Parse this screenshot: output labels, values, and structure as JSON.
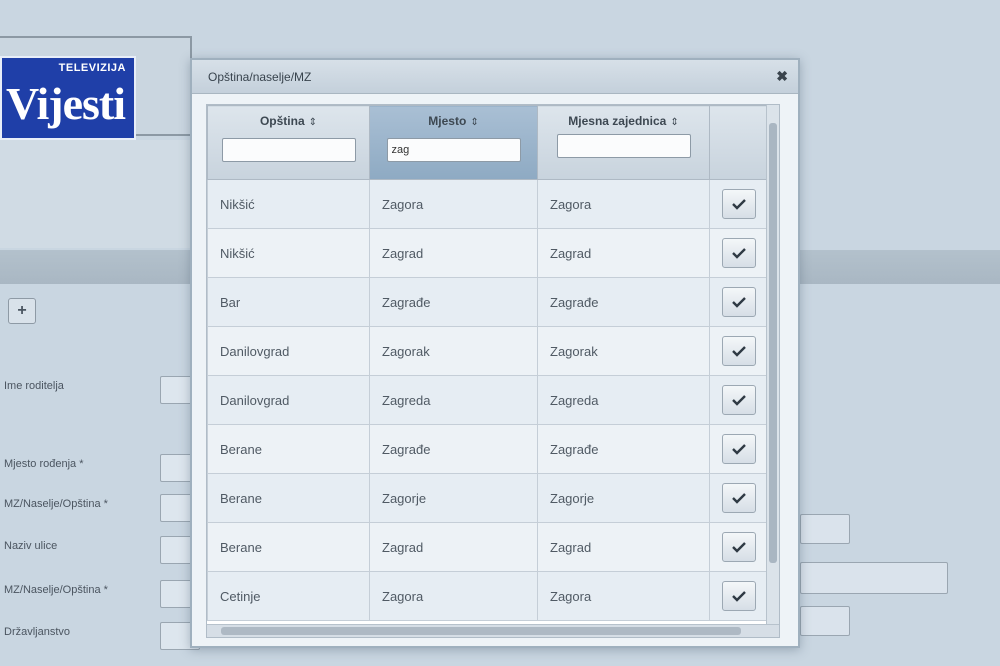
{
  "logo": {
    "sub": "TELEVIZIJA",
    "main": "Vijesti"
  },
  "background_form": {
    "plus_label": "+",
    "labels": [
      "Ime roditelja",
      "Mjesto rođenja *",
      "MZ/Naselje/Opština *",
      "Naziv ulice",
      "MZ/Naselje/Opština *",
      "Državljanstvo"
    ]
  },
  "dialog": {
    "title": "Opština/naselje/MZ",
    "close_label": "✖",
    "columns": [
      {
        "label": "Opština",
        "sort": "⇕",
        "filter_value": ""
      },
      {
        "label": "Mjesto",
        "sort": "⇕",
        "filter_value": "zag"
      },
      {
        "label": "Mjesna zajednica",
        "sort": "⇕",
        "filter_value": ""
      }
    ],
    "rows": [
      [
        "Nikšić",
        "Zagora",
        "Zagora"
      ],
      [
        "Nikšić",
        "Zagrad",
        "Zagrad"
      ],
      [
        "Bar",
        "Zagrađe",
        "Zagrađe"
      ],
      [
        "Danilovgrad",
        "Zagorak",
        "Zagorak"
      ],
      [
        "Danilovgrad",
        "Zagreda",
        "Zagreda"
      ],
      [
        "Berane",
        "Zagrađe",
        "Zagrađe"
      ],
      [
        "Berane",
        "Zagorje",
        "Zagorje"
      ],
      [
        "Berane",
        "Zagrad",
        "Zagrad"
      ],
      [
        "Cetinje",
        "Zagora",
        "Zagora"
      ]
    ]
  },
  "colors": {
    "logo_bg": "#1f3fa8",
    "active_header": "#9db5cc"
  }
}
